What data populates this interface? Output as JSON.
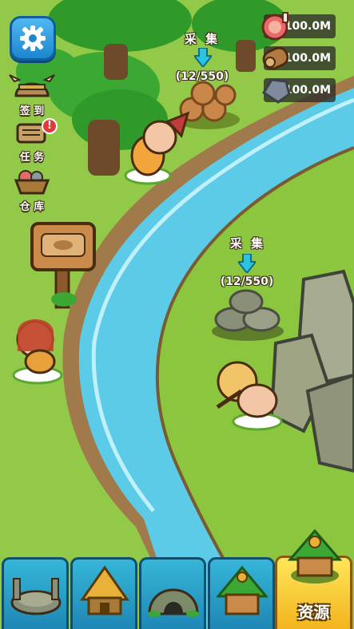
{
  "top_left": {
    "settings_icon": "gear-icon",
    "buttons": [
      {
        "label": "签 到",
        "icon": "viking-helmet-icon"
      },
      {
        "label": "任 务",
        "icon": "scroll-icon",
        "badge": "!"
      },
      {
        "label": "仓 库",
        "icon": "storage-basket-icon"
      }
    ]
  },
  "resources": [
    {
      "icon": "meat-icon",
      "value": "100.0M"
    },
    {
      "icon": "wood-log-icon",
      "value": "100.0M"
    },
    {
      "icon": "stone-icon",
      "value": "100.0M"
    }
  ],
  "gather_points": [
    {
      "label": "采 集",
      "count": "(12/550)",
      "resource": "wood"
    },
    {
      "label": "采 集",
      "count": "(12/550)",
      "resource": "stone"
    }
  ],
  "bottom_tabs": [
    {
      "icon": "arena-icon",
      "label": ""
    },
    {
      "icon": "straw-hut-icon",
      "label": ""
    },
    {
      "icon": "cave-icon",
      "label": ""
    },
    {
      "icon": "leaf-hut-icon",
      "label": ""
    },
    {
      "icon": "resource-hut-icon",
      "label": "资源",
      "active": true
    }
  ],
  "colors": {
    "grass": "#8cc63f",
    "river": "#5ccbe8",
    "tab_blue": "#1e86b4",
    "tab_active": "#f2b31c"
  }
}
